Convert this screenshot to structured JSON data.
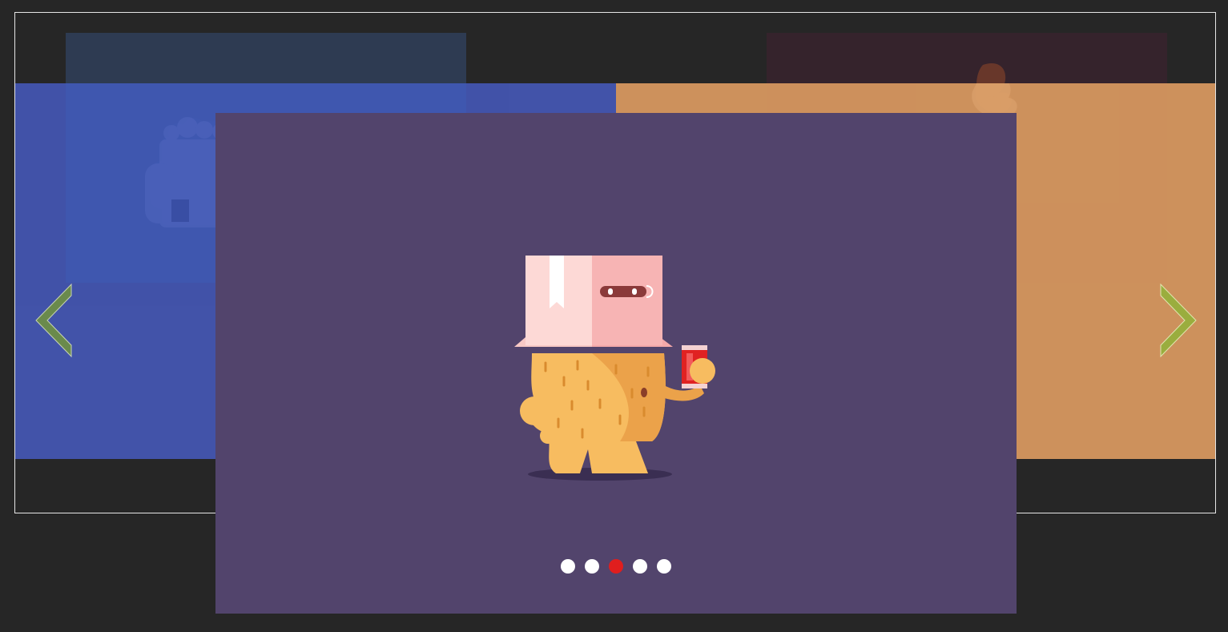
{
  "carousel": {
    "colors": {
      "page_background": "#262626",
      "frame_border": "#e6e6e6",
      "slide_far_left": "#2e3b52",
      "slide_far_right": "#35232c",
      "slide_left": "#4355b0",
      "slide_right": "#d6975f",
      "slide_center": "#52446c",
      "arrow_prev": "#6a8a4c",
      "arrow_next": "#9aad3e",
      "dot_inactive": "#ffffff",
      "dot_active": "#e01e1e"
    },
    "slides": [
      {
        "illustration": "gift-box-character",
        "position": "far-left"
      },
      {
        "illustration": "gift-box-character",
        "position": "left"
      },
      {
        "illustration": "box-head-monster-with-soda-can",
        "position": "center"
      },
      {
        "illustration": "fire-character",
        "position": "right"
      },
      {
        "illustration": "fire-character",
        "position": "far-right"
      }
    ],
    "controls": {
      "prev_icon": "chevron-left-icon",
      "next_icon": "chevron-right-icon"
    },
    "pagination": {
      "count": 5,
      "active_index": 2
    }
  }
}
